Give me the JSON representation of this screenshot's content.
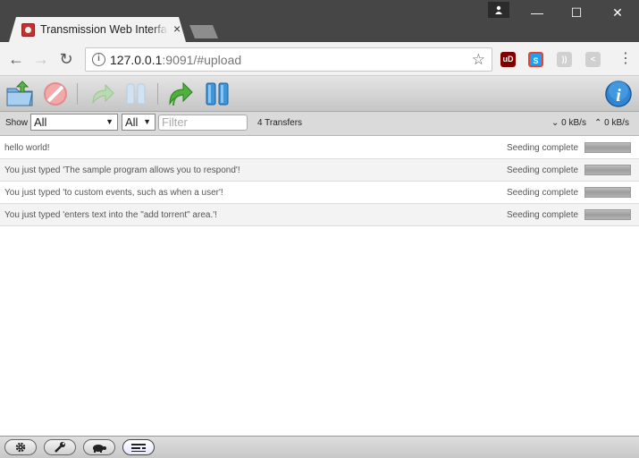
{
  "browser": {
    "tab_title": "Transmission Web Interface",
    "tab_close": "×",
    "profile_icon": "person-icon",
    "url_host": "127.0.0.1",
    "url_rest": ":9091/#upload",
    "info_glyph": "i",
    "star_glyph": "☆",
    "back_glyph": "←",
    "forward_glyph": "→",
    "reload_glyph": "↻",
    "minimize_glyph": "—",
    "maximize_glyph": "☐",
    "close_glyph": "✕",
    "menu_glyph": "⋮",
    "extensions": [
      {
        "name": "ublock",
        "label": "uD",
        "color": "#800000"
      },
      {
        "name": "skype",
        "label": "S",
        "color": "#1ea0f1"
      },
      {
        "name": "rss",
        "label": "))",
        "color": "#d0d0d0"
      },
      {
        "name": "share",
        "label": "<",
        "color": "#d0d0d0"
      }
    ]
  },
  "toolbar": {
    "open_icon": "open-folder-icon",
    "remove_icon": "remove-icon",
    "resume_icon": "resume-icon",
    "pause_icon": "pause-icon",
    "resume_all_icon": "resume-all-icon",
    "pause_all_icon": "pause-all-icon",
    "inspector_icon": "inspector-info-icon",
    "inspector_glyph": "i"
  },
  "filterbar": {
    "show_label": "Show",
    "status_filter": "All",
    "tracker_filter": "All",
    "filter_placeholder": "Filter",
    "transfers": "4 Transfers",
    "down_speed": "0 kB/s",
    "up_speed": "0 kB/s"
  },
  "torrents": [
    {
      "name": "hello world!",
      "status": "Seeding complete",
      "progress": 1.0
    },
    {
      "name": "You just typed 'The sample program allows you to respond'!",
      "status": "Seeding complete",
      "progress": 1.0
    },
    {
      "name": "You just typed 'to custom events, such as when a user'!",
      "status": "Seeding complete",
      "progress": 1.0
    },
    {
      "name": "You just typed 'enters text into the \"add torrent\" area.'!",
      "status": "Seeding complete",
      "progress": 1.0
    }
  ],
  "bottombar": {
    "settings_icon": "gear-icon",
    "prefs_icon": "wrench-icon",
    "turtle_icon": "turtle-icon",
    "compact_icon": "compact-view-icon"
  }
}
